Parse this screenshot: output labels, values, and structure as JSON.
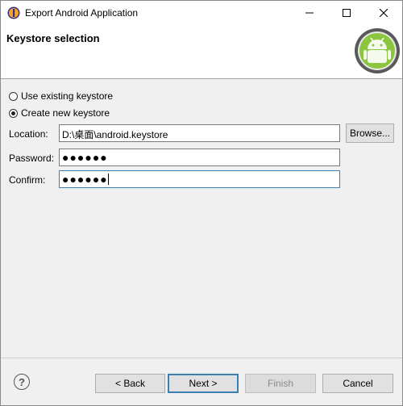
{
  "window": {
    "title": "Export Android Application"
  },
  "header": {
    "title": "Keystore selection"
  },
  "options": {
    "use_existing": {
      "label": "Use existing keystore",
      "checked": false
    },
    "create_new": {
      "label": "Create new keystore",
      "checked": true
    }
  },
  "form": {
    "location_label": "Location:",
    "location_value": "D:\\桌面\\android.keystore",
    "browse_label": "Browse...",
    "password_label": "Password:",
    "password_mask": "●●●●●●",
    "confirm_label": "Confirm:",
    "confirm_mask": "●●●●●●"
  },
  "footer": {
    "help_symbol": "?",
    "back_label": "< Back",
    "next_label": "Next >",
    "finish_label": "Finish",
    "cancel_label": "Cancel"
  },
  "colors": {
    "accent": "#3c7fb1",
    "android_green": "#8cc63f"
  },
  "icons": [
    "app-icon",
    "minimize-icon",
    "maximize-icon",
    "close-icon",
    "android-logo",
    "help-icon"
  ]
}
